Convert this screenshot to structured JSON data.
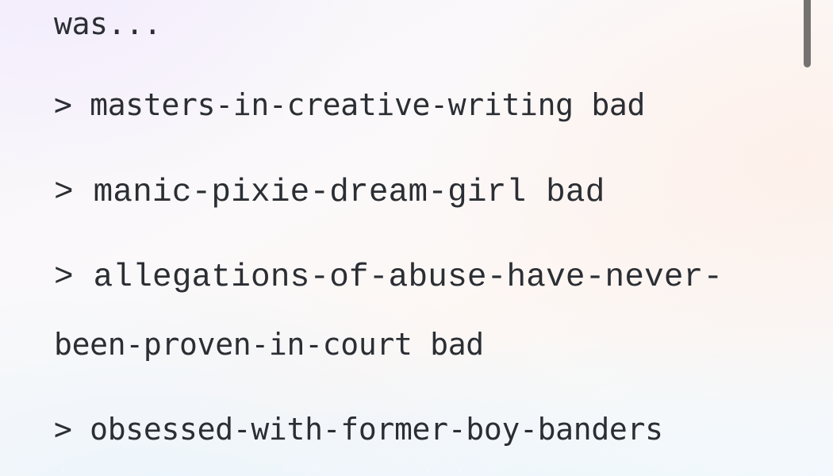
{
  "view": {
    "background_top_left": "#f7f4fb",
    "background_right": "#fdf6f4",
    "background_bottom": "#f0f8fd",
    "text_color": "#2b2e33"
  },
  "content": {
    "lines": [
      {
        "text": "was...",
        "style": "sans-mono",
        "is_quote": false,
        "wrapped_continuation": false
      },
      {
        "text": "> masters-in-creative-writing bad",
        "style": "sans-mono",
        "is_quote": true,
        "wrapped_continuation": false
      },
      {
        "text": "> manic-pixie-dream-girl bad",
        "style": "serif-mono",
        "is_quote": true,
        "wrapped_continuation": false
      },
      {
        "text": "> allegations-of-abuse-have-never-",
        "style": "serif-mono",
        "is_quote": true,
        "wrapped_continuation": false
      },
      {
        "text": "been-proven-in-court bad",
        "style": "sans-mono",
        "is_quote": false,
        "wrapped_continuation": true
      },
      {
        "text": "> obsessed-with-former-boy-banders",
        "style": "sans-mono",
        "is_quote": true,
        "wrapped_continuation": false
      }
    ]
  },
  "scrollbar": {
    "thumb_color": "#76726f",
    "orientation": "vertical",
    "position": "near-top"
  }
}
